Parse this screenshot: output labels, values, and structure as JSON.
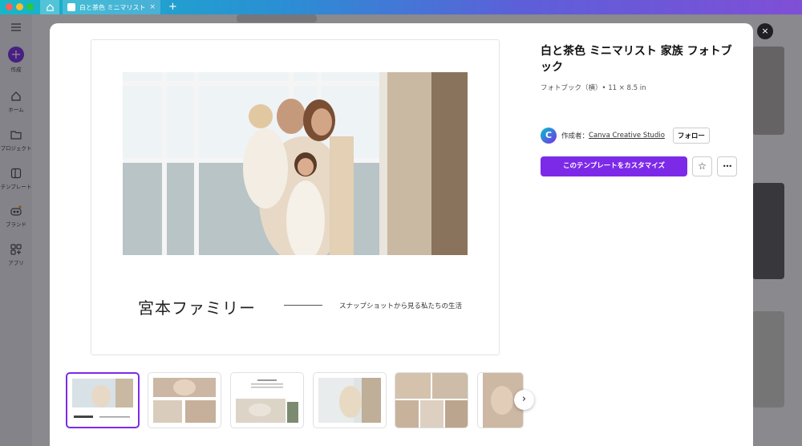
{
  "window": {
    "tab_title": "白と茶色 ミニマリスト...",
    "tab_close": "×",
    "new_tab": "+"
  },
  "sidebar": {
    "menu_icon": "menu-icon",
    "items": [
      {
        "label": "作成",
        "icon": "plus-icon"
      },
      {
        "label": "ホーム",
        "icon": "home-icon"
      },
      {
        "label": "プロジェクト",
        "icon": "folder-icon"
      },
      {
        "label": "テンプレート",
        "icon": "template-icon"
      },
      {
        "label": "ブランド",
        "icon": "brand-icon"
      },
      {
        "label": "アプリ",
        "icon": "apps-icon"
      }
    ]
  },
  "modal": {
    "close": "×",
    "preview": {
      "family_name": "宮本ファミリー",
      "tagline": "スナップショットから見る私たちの生活"
    },
    "thumbnails_count": 6,
    "active_thumbnail": 1,
    "next": "›",
    "info": {
      "title": "白と茶色 ミニマリスト 家族 フォトブック",
      "subtitle": "フォトブック（横）• 11 × 8.5 in",
      "author_prefix": "作成者：",
      "author_name": "Canva Creative Studio",
      "avatar_letter": "C",
      "follow": "フォロー",
      "customize": "このテンプレートをカスタマイズ",
      "star": "☆",
      "more": "•••"
    }
  },
  "colors": {
    "accent": "#7d2ae8",
    "titlebar_start": "#16b7c8",
    "titlebar_end": "#7f4fd6"
  }
}
